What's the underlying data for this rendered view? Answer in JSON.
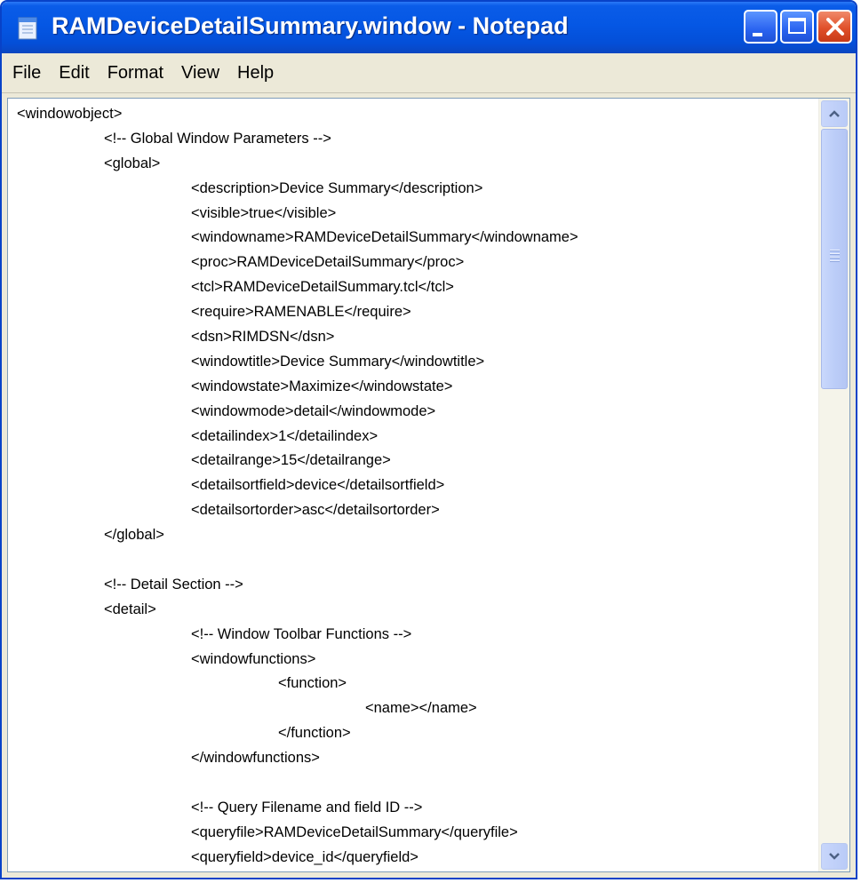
{
  "window": {
    "title": "RAMDeviceDetailSummary.window - Notepad",
    "icon": "notepad-icon",
    "title_color": "#0557e4",
    "close_color": "#e0502a"
  },
  "menu": {
    "items": [
      "File",
      "Edit",
      "Format",
      "View",
      "Help"
    ]
  },
  "document": {
    "lines": [
      "<windowobject>",
      "\t<!-- Global Window Parameters -->",
      "\t<global>",
      "\t\t<description>Device Summary</description>",
      "\t\t<visible>true</visible>",
      "\t\t<windowname>RAMDeviceDetailSummary</windowname>",
      "\t\t<proc>RAMDeviceDetailSummary</proc>",
      "\t\t<tcl>RAMDeviceDetailSummary.tcl</tcl>",
      "\t\t<require>RAMENABLE</require>",
      "\t\t<dsn>RIMDSN</dsn>",
      "\t\t<windowtitle>Device Summary</windowtitle>",
      "\t\t<windowstate>Maximize</windowstate>",
      "\t\t<windowmode>detail</windowmode>",
      "\t\t<detailindex>1</detailindex>",
      "\t\t<detailrange>15</detailrange>",
      "\t\t<detailsortfield>device</detailsortfield>",
      "\t\t<detailsortorder>asc</detailsortorder>",
      "\t</global>",
      "",
      "\t<!-- Detail Section -->",
      "\t<detail>",
      "\t\t<!-- Window Toolbar Functions -->",
      "\t\t<windowfunctions>",
      "\t\t\t<function>",
      "\t\t\t\t<name></name>",
      "\t\t\t</function>",
      "\t\t</windowfunctions>",
      "",
      "\t\t<!-- Query Filename and field ID -->",
      "\t\t<queryfile>RAMDeviceDetailSummary</queryfile>",
      "\t\t<queryfield>device_id</queryfield>"
    ]
  },
  "scrollbar": {
    "position_fraction": 0.0,
    "visible_fraction": 0.36
  }
}
